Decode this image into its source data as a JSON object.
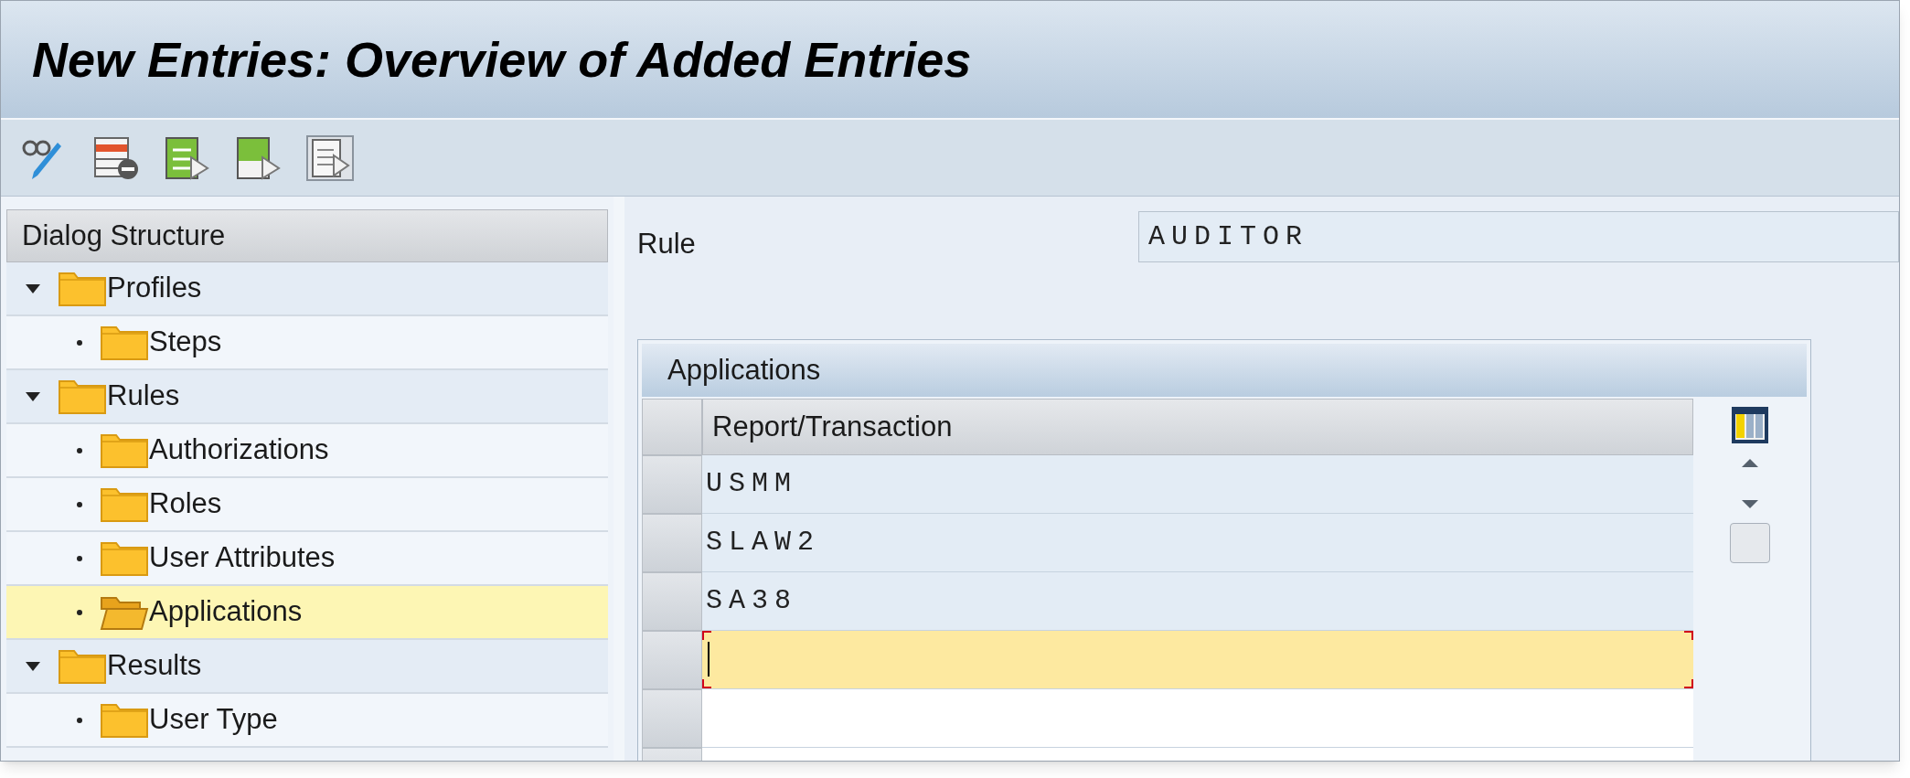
{
  "window": {
    "title": "New Entries: Overview of Added Entries"
  },
  "toolbar": [
    {
      "kind": "glasses-pen"
    },
    {
      "kind": "delete-rows"
    },
    {
      "kind": "select-all"
    },
    {
      "kind": "select-block"
    },
    {
      "kind": "deselect-all"
    }
  ],
  "dialog_structure": {
    "title": "Dialog Structure",
    "items": [
      {
        "label": "Profiles",
        "expanded": true,
        "selected": false,
        "children": [
          {
            "label": "Steps",
            "selected": false
          }
        ]
      },
      {
        "label": "Rules",
        "expanded": true,
        "selected": false,
        "children": [
          {
            "label": "Authorizations",
            "selected": false
          },
          {
            "label": "Roles",
            "selected": false
          },
          {
            "label": "User Attributes",
            "selected": false
          },
          {
            "label": "Applications",
            "selected": true
          }
        ]
      },
      {
        "label": "Results",
        "expanded": true,
        "selected": false,
        "children": [
          {
            "label": "User Type",
            "selected": false
          }
        ]
      }
    ]
  },
  "rule": {
    "label": "Rule",
    "value": "AUDITOR"
  },
  "table": {
    "title": "Applications",
    "columns": [
      "Report/Transaction"
    ],
    "rows": [
      {
        "value": "USMM",
        "focused": false
      },
      {
        "value": "SLAW2",
        "focused": false
      },
      {
        "value": "SA38",
        "focused": false
      },
      {
        "focused": true
      },
      {
        "focused": false
      },
      {
        "focused": false
      }
    ]
  }
}
